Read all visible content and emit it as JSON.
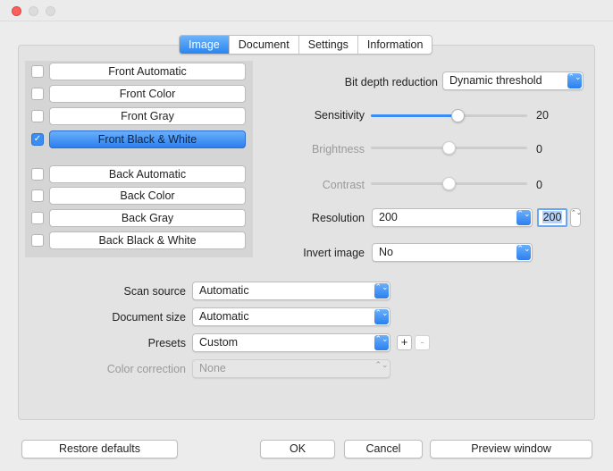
{
  "window": {
    "title": ""
  },
  "tabs": [
    {
      "label": "Image",
      "active": true
    },
    {
      "label": "Document",
      "active": false
    },
    {
      "label": "Settings",
      "active": false
    },
    {
      "label": "Information",
      "active": false
    }
  ],
  "modes": [
    {
      "label": "Front Automatic",
      "checked": false,
      "selected": false
    },
    {
      "label": "Front Color",
      "checked": false,
      "selected": false
    },
    {
      "label": "Front Gray",
      "checked": false,
      "selected": false
    },
    {
      "label": "Front Black & White",
      "checked": true,
      "selected": true
    },
    {
      "label": "Back Automatic",
      "checked": false,
      "selected": false
    },
    {
      "label": "Back Color",
      "checked": false,
      "selected": false
    },
    {
      "label": "Back Gray",
      "checked": false,
      "selected": false
    },
    {
      "label": "Back Black & White",
      "checked": false,
      "selected": false
    }
  ],
  "bit_depth": {
    "label": "Bit depth reduction",
    "value": "Dynamic threshold"
  },
  "sensitivity": {
    "label": "Sensitivity",
    "value": "20",
    "level": 0.56
  },
  "brightness": {
    "label": "Brightness",
    "value": "0",
    "level": 0.5,
    "enabled": false
  },
  "contrast": {
    "label": "Contrast",
    "value": "0",
    "level": 0.5,
    "enabled": false
  },
  "resolution": {
    "label": "Resolution",
    "value": "200",
    "field_value": "200"
  },
  "invert": {
    "label": "Invert image",
    "value": "No"
  },
  "scan_source": {
    "label": "Scan source",
    "value": "Automatic"
  },
  "document_size": {
    "label": "Document size",
    "value": "Automatic"
  },
  "presets": {
    "label": "Presets",
    "value": "Custom",
    "add_label": "+",
    "remove_label": "-"
  },
  "color_correction": {
    "label": "Color correction",
    "value": "None",
    "enabled": false
  },
  "buttons": {
    "restore": "Restore defaults",
    "ok": "OK",
    "cancel": "Cancel",
    "preview": "Preview window"
  },
  "glyphs": {
    "check": "✓",
    "updown": "⌃⌄"
  },
  "colors": {
    "accent": "#3b8df4",
    "close": "#fc605c"
  }
}
